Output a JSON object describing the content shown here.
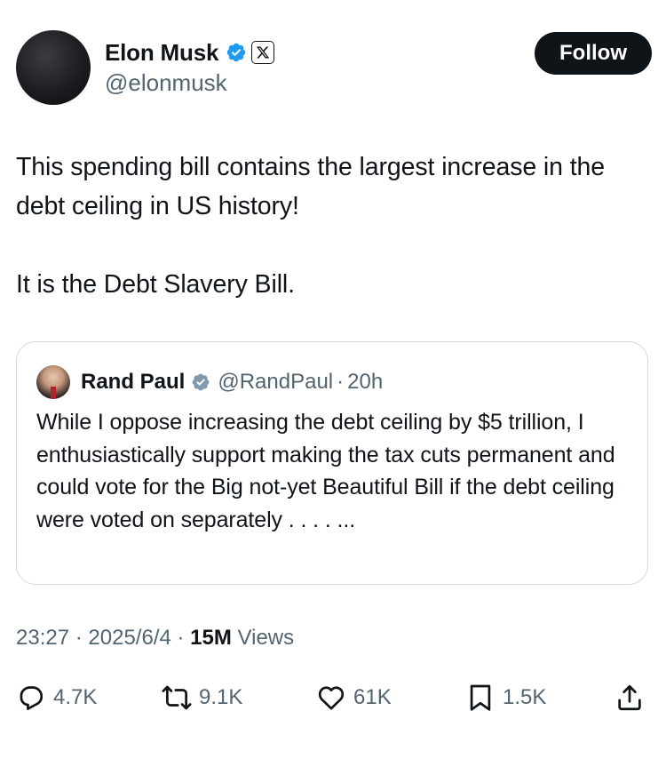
{
  "author": {
    "name": "Elon Musk",
    "handle": "@elonmusk",
    "follow_label": "Follow"
  },
  "tweet": {
    "text": "This spending bill contains the largest increase in the debt ceiling in US history!\n\nIt is the Debt Slavery Bill."
  },
  "quote": {
    "name": "Rand Paul",
    "handle": "@RandPaul",
    "separator": "·",
    "time": "20h",
    "text": "While I oppose increasing the debt ceiling by $5 trillion, I enthusiastically support making the tax cuts permanent and could vote for the Big not-yet Beautiful Bill if the debt ceiling were voted on separately . . . . ..."
  },
  "meta": {
    "time": "23:27",
    "date": "2025/6/4",
    "sep": "·",
    "views_count": "15M",
    "views_label": "Views"
  },
  "actions": {
    "replies": "4.7K",
    "reposts": "9.1K",
    "likes": "61K",
    "bookmarks": "1.5K"
  },
  "icons": {
    "verified": "verified-badge-icon",
    "affiliate": "x-logo-icon",
    "reply": "reply-icon",
    "repost": "repost-icon",
    "like": "heart-icon",
    "bookmark": "bookmark-icon",
    "share": "share-icon"
  },
  "colors": {
    "verified_blue": "#1d9bf0",
    "text": "#0f1419",
    "secondary": "#536471",
    "border": "#cfd9de"
  }
}
